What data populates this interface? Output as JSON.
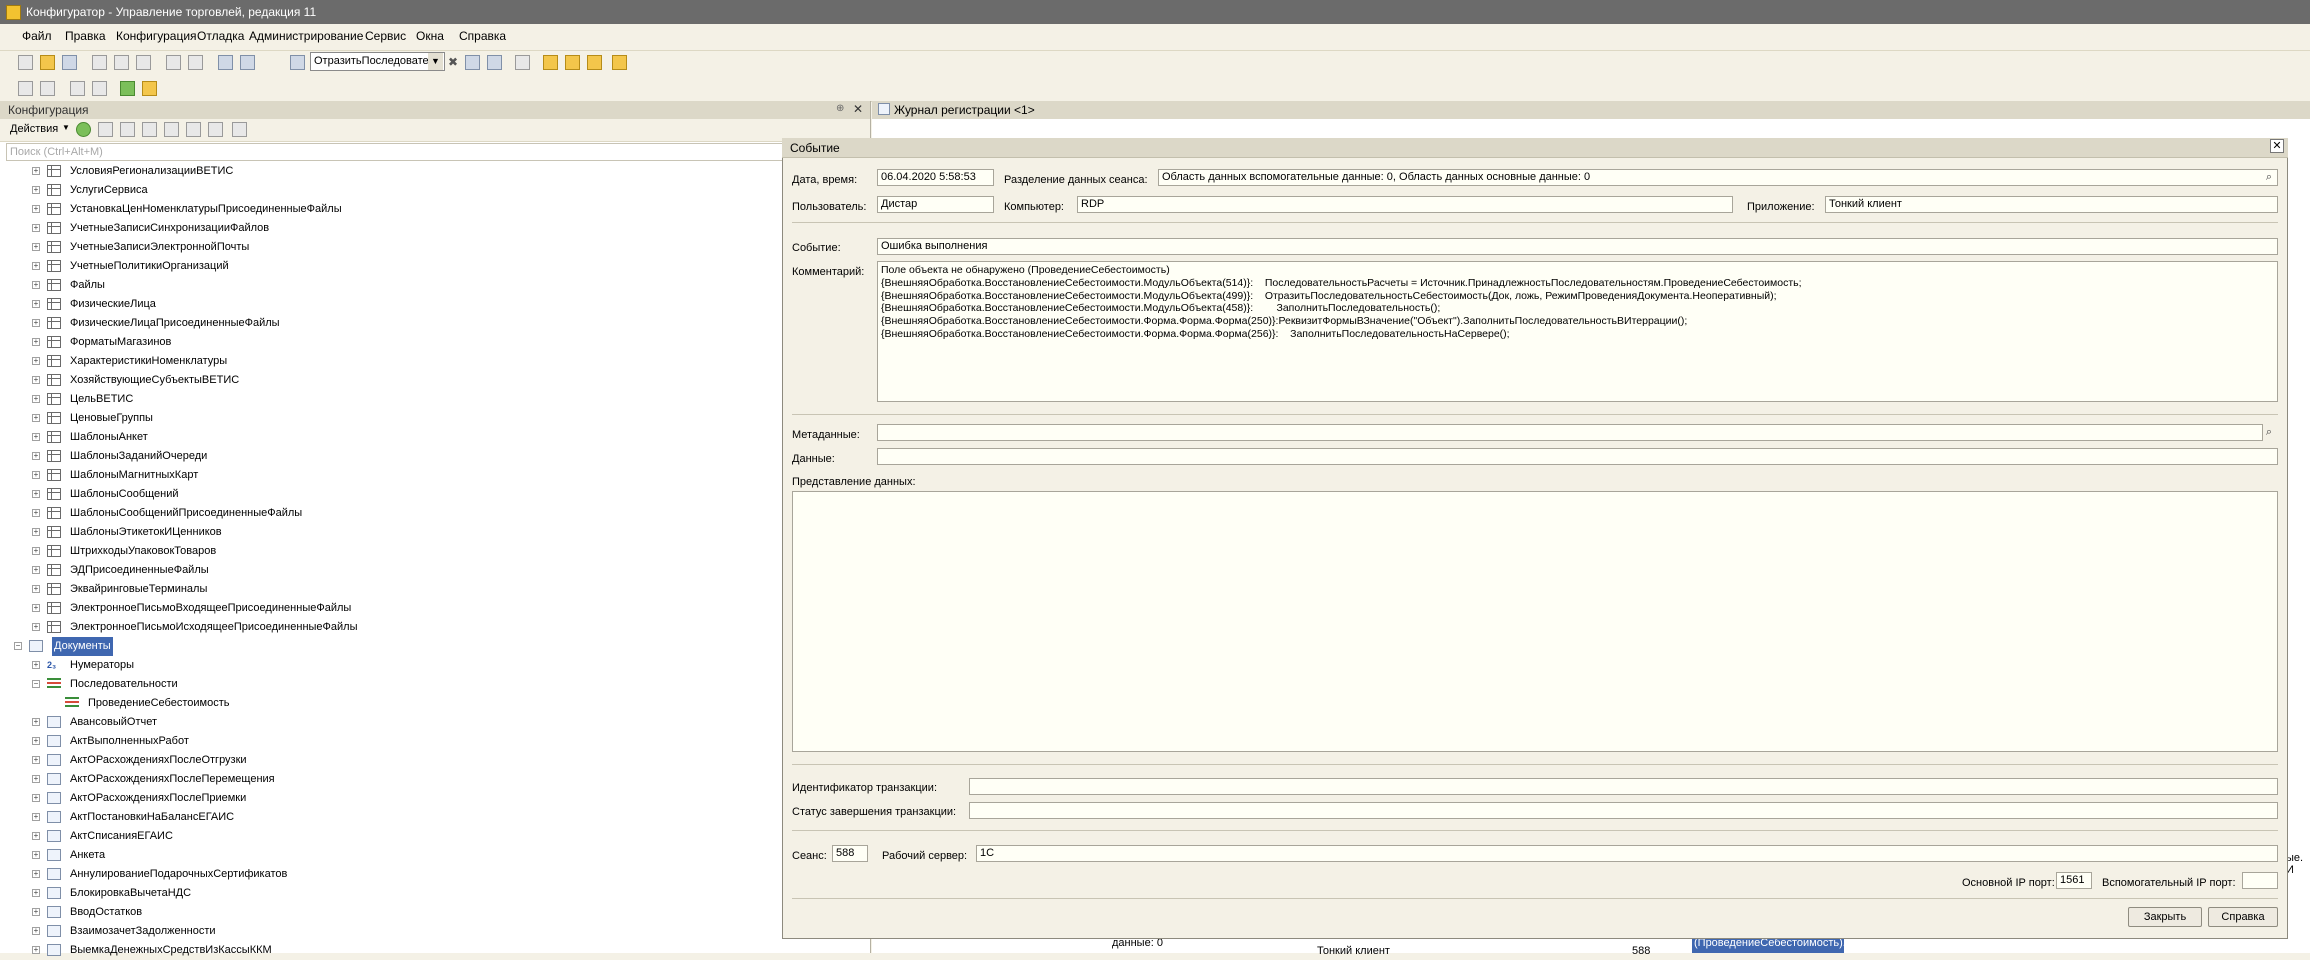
{
  "app": {
    "title": "Конфигуратор - Управление торговлей, редакция 11"
  },
  "menu": [
    "Файл",
    "Правка",
    "Конфигурация",
    "Отладка",
    "Администрирование",
    "Сервис",
    "Окна",
    "Справка"
  ],
  "toolbar": {
    "combo_value": "ОтразитьПоследовате"
  },
  "left_panel": {
    "title": "Конфигурация",
    "actions_label": "Действия",
    "search_placeholder": "Поиск (Ctrl+Alt+M)",
    "tree": [
      {
        "label": "УсловияРегионализацииВЕТИС",
        "icon": "table-icon",
        "level": 2
      },
      {
        "label": "УслугиСервиса",
        "icon": "table-icon",
        "level": 2
      },
      {
        "label": "УстановкаЦенНоменклатурыПрисоединенныеФайлы",
        "icon": "table-icon",
        "level": 2
      },
      {
        "label": "УчетныеЗаписиСинхронизацииФайлов",
        "icon": "table-icon",
        "level": 2
      },
      {
        "label": "УчетныеЗаписиЭлектроннойПочты",
        "icon": "table-icon",
        "level": 2
      },
      {
        "label": "УчетныеПолитикиОрганизаций",
        "icon": "table-icon",
        "level": 2
      },
      {
        "label": "Файлы",
        "icon": "table-icon",
        "level": 2
      },
      {
        "label": "ФизическиеЛица",
        "icon": "table-icon",
        "level": 2
      },
      {
        "label": "ФизическиеЛицаПрисоединенныеФайлы",
        "icon": "table-icon",
        "level": 2
      },
      {
        "label": "ФорматыМагазинов",
        "icon": "table-icon",
        "level": 2
      },
      {
        "label": "ХарактеристикиНоменклатуры",
        "icon": "table-icon",
        "level": 2
      },
      {
        "label": "ХозяйствующиеСубъектыВЕТИС",
        "icon": "table-icon",
        "level": 2
      },
      {
        "label": "ЦельВЕТИС",
        "icon": "table-icon",
        "level": 2
      },
      {
        "label": "ЦеновыеГруппы",
        "icon": "table-icon",
        "level": 2
      },
      {
        "label": "ШаблоныАнкет",
        "icon": "table-icon",
        "level": 2
      },
      {
        "label": "ШаблоныЗаданийОчереди",
        "icon": "table-icon",
        "level": 2
      },
      {
        "label": "ШаблоныМагнитныхКарт",
        "icon": "table-icon",
        "level": 2
      },
      {
        "label": "ШаблоныСообщений",
        "icon": "table-icon",
        "level": 2
      },
      {
        "label": "ШаблоныСообщенийПрисоединенныеФайлы",
        "icon": "table-icon",
        "level": 2
      },
      {
        "label": "ШаблоныЭтикетокИЦенников",
        "icon": "table-icon",
        "level": 2
      },
      {
        "label": "ШтрихкодыУпаковокТоваров",
        "icon": "table-icon",
        "level": 2
      },
      {
        "label": "ЭДПрисоединенныеФайлы",
        "icon": "table-icon",
        "level": 2
      },
      {
        "label": "ЭквайринговыеТерминалы",
        "icon": "table-icon",
        "level": 2
      },
      {
        "label": "ЭлектронноеПисьмоВходящееПрисоединенныеФайлы",
        "icon": "table-icon",
        "level": 2
      },
      {
        "label": "ЭлектронноеПисьмоИсходящееПрисоединенныеФайлы",
        "icon": "table-icon",
        "level": 2
      },
      {
        "label": "Документы",
        "icon": "documents-icon",
        "level": 1,
        "selected": true,
        "expanded": true
      },
      {
        "label": "Нумераторы",
        "icon": "numerators-icon",
        "level": 2
      },
      {
        "label": "Последовательности",
        "icon": "sequence-icon",
        "level": 2,
        "expanded": true
      },
      {
        "label": "ПроведениеСебестоимость",
        "icon": "sequence-icon",
        "level": 3
      },
      {
        "label": "АвансовыйОтчет",
        "icon": "document-icon",
        "level": 2
      },
      {
        "label": "АктВыполненныхРабот",
        "icon": "document-icon",
        "level": 2
      },
      {
        "label": "АктОРасхожденияхПослеОтгрузки",
        "icon": "document-icon",
        "level": 2
      },
      {
        "label": "АктОРасхожденияхПослеПеремещения",
        "icon": "document-icon",
        "level": 2
      },
      {
        "label": "АктОРасхожденияхПослеПриемки",
        "icon": "document-icon",
        "level": 2
      },
      {
        "label": "АктПостановкиНаБалансЕГАИС",
        "icon": "document-icon",
        "level": 2
      },
      {
        "label": "АктСписанияЕГАИС",
        "icon": "document-icon",
        "level": 2
      },
      {
        "label": "Анкета",
        "icon": "document-icon",
        "level": 2
      },
      {
        "label": "АннулированиеПодарочныхСертификатов",
        "icon": "document-icon",
        "level": 2
      },
      {
        "label": "БлокировкаВычетаНДС",
        "icon": "document-icon",
        "level": 2
      },
      {
        "label": "ВводОстатков",
        "icon": "document-icon",
        "level": 2
      },
      {
        "label": "ВзаимозачетЗадолженности",
        "icon": "document-icon",
        "level": 2
      },
      {
        "label": "ВыемкаДенежныхСредствИзКассыККМ",
        "icon": "document-icon",
        "level": 2
      }
    ]
  },
  "journal": {
    "title": "Журнал регистрации <1>",
    "partial_texts": {
      "data_cell": "данные: 0",
      "client_cell": "Тонкий клиент",
      "num_cell": "588",
      "selected_cell": "(ПроведениеСебестоимость)...",
      "right_edge": "ые. И"
    }
  },
  "dialog": {
    "title": "Событие",
    "labels": {
      "datetime": "Дата, время:",
      "separation": "Разделение данных сеанса:",
      "user": "Пользователь:",
      "computer": "Компьютер:",
      "application": "Приложение:",
      "event": "Событие:",
      "comment": "Комментарий:",
      "metadata": "Метаданные:",
      "data": "Данные:",
      "data_presentation": "Представление данных:",
      "transaction_id": "Идентификатор транзакции:",
      "transaction_status": "Статус завершения транзакции:",
      "session": "Сеанс:",
      "work_server": "Рабочий сервер:",
      "main_ip_port": "Основной IP порт:",
      "aux_ip_port": "Вспомогательный IP порт:"
    },
    "values": {
      "datetime": "06.04.2020  5:58:53",
      "separation": "Область данных вспомогательные данные: 0, Область данных основные данные: 0",
      "user": "Дистар",
      "computer": "RDP",
      "application": "Тонкий клиент",
      "event": "Ошибка выполнения",
      "comment": "Поле объекта не обнаружено (ПроведениеСебестоимость)\n{ВнешняяОбработка.ВосстановлениеСебестоимости.МодульОбъекта(514)}:    ПоследовательностьРасчеты = Источник.ПринадлежностьПоследовательностям.ПроведениеСебестоимость;\n{ВнешняяОбработка.ВосстановлениеСебестоимости.МодульОбъекта(499)}:    ОтразитьПоследовательностьСебестоимость(Док, ложь, РежимПроведенияДокумента.Неоперативный);\n{ВнешняяОбработка.ВосстановлениеСебестоимости.МодульОбъекта(458)}:        ЗаполнитьПоследовательность();\n{ВнешняяОбработка.ВосстановлениеСебестоимости.Форма.Форма.Форма(250)}:РеквизитФормыВЗначение(\"Объект\").ЗаполнитьПоследовательностьВИтеррации();\n{ВнешняяОбработка.ВосстановлениеСебестоимости.Форма.Форма.Форма(256)}:    ЗаполнитьПоследовательностьНаСервере();",
      "metadata": "",
      "data": "",
      "data_presentation": "",
      "transaction_id": "",
      "transaction_status": "",
      "session": "588",
      "work_server": "1С",
      "main_ip_port": "1561",
      "aux_ip_port": ""
    },
    "buttons": {
      "close": "Закрыть",
      "help": "Справка"
    }
  }
}
